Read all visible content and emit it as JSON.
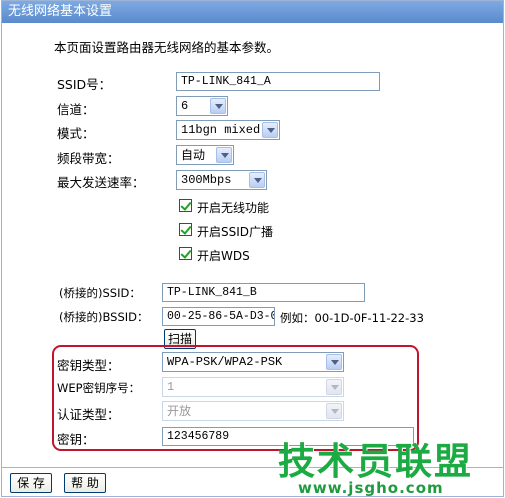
{
  "window": {
    "title": "无线网络基本设置"
  },
  "description": "本页面设置路由器无线网络的基本参数。",
  "form": {
    "ssid": {
      "label": "SSID号：",
      "value": "TP-LINK_841_A"
    },
    "channel": {
      "label": "信道：",
      "value": "6"
    },
    "mode": {
      "label": "模式：",
      "value": "11bgn mixed"
    },
    "bandwidth": {
      "label": "频段带宽：",
      "value": "自动"
    },
    "max_rate": {
      "label": "最大发送速率：",
      "value": "300Mbps"
    },
    "checkboxes": [
      {
        "label": "开启无线功能",
        "checked": true
      },
      {
        "label": "开启SSID广播",
        "checked": true
      },
      {
        "label": "开启WDS",
        "checked": true
      }
    ]
  },
  "bridge": {
    "ssid": {
      "label": "(桥接的)SSID：",
      "value": "TP-LINK_841_B"
    },
    "bssid": {
      "label": "(桥接的)BSSID：",
      "value": "00-25-86-5A-D3-06",
      "example": "例如：00-1D-0F-11-22-33"
    },
    "scan_label": "扫描"
  },
  "security": {
    "key_type": {
      "label": "密钥类型：",
      "value": "WPA-PSK/WPA2-PSK"
    },
    "wep_index": {
      "label": "WEP密钥序号：",
      "value": "1"
    },
    "auth_type": {
      "label": "认证类型：",
      "value": "开放"
    },
    "key": {
      "label": "密钥：",
      "value": "123456789"
    }
  },
  "footer": {
    "save_label": "保 存",
    "help_label": "帮 助"
  },
  "watermark": {
    "text": "技术员联盟",
    "url": "www.jsgho.com"
  },
  "colors": {
    "title_bar": "#6a9ad8",
    "highlight": "#c0152d",
    "watermark": "#1caa43",
    "check": "#21a121"
  }
}
